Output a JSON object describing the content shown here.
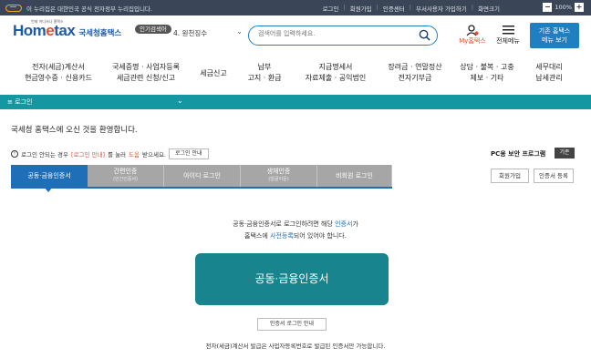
{
  "topbar": {
    "notice": "이 누리집은 대한민국 공식 전자정부 누리집입니다.",
    "links": [
      "로그인",
      "회원가입",
      "인증센터",
      "부서사용자 가입하기",
      "화면크기"
    ],
    "zoom": "100%",
    "zoom_minus": "−",
    "zoom_plus": "+"
  },
  "header": {
    "logo_home": "Hom",
    "logo_e": "e",
    "logo_tax": "tax",
    "logo_org": "국세청홈택스",
    "logo_tiny": "언제 어디서나 홈택스",
    "popular_label": "인기검색어",
    "popular_item": "4. 원천징수",
    "search_placeholder": "검색어를 입력하세요.",
    "my_home": "My홈택스",
    "all_menu": "전체메뉴",
    "old_home_line1": "기존 홈택스",
    "old_home_line2": "메뉴 보기"
  },
  "nav": [
    {
      "line1": "전자(세금)계산서",
      "line2": "현금영수증 · 신용카드"
    },
    {
      "line1": "국세증명 · 사업자등록",
      "line2": "세금관련 신청/신고"
    },
    {
      "line1": "세금신고",
      "line2": ""
    },
    {
      "line1": "납부",
      "line2": "고지 · 환급"
    },
    {
      "line1": "지급명세서",
      "line2": "자료제출 · 공익법인"
    },
    {
      "line1": "장려금 · 연말정산",
      "line2": "전자기부금"
    },
    {
      "line1": "상담 · 불복 · 고충",
      "line2": "제보 · 기타"
    },
    {
      "line1": "세무대리",
      "line2": "납세관리"
    }
  ],
  "loginbar": {
    "label": "≡  로그인",
    "chevron": "⌄"
  },
  "welcome": "국세청 홈택스에 오신 것을 환영합니다.",
  "hint": {
    "prefix": "로그인 안되는 경우",
    "red": "[로그인 안내]",
    "middle": "를 눌러",
    "help": "도움",
    "suffix": "받으세요.",
    "button": "로그인 안내"
  },
  "pc_security": {
    "label": "PC용 보안 프로그램",
    "button": "기존"
  },
  "tabs": [
    {
      "label": "공동·금융인증서",
      "sub": ""
    },
    {
      "label": "간편인증",
      "sub": "(민간인증서)"
    },
    {
      "label": "아이디 로그인",
      "sub": ""
    },
    {
      "label": "생체인증",
      "sub": "(얼굴지문)"
    },
    {
      "label": "비회원 로그인",
      "sub": ""
    }
  ],
  "side_buttons": {
    "join": "회원가입",
    "cert_register": "인증서 등록"
  },
  "description": {
    "line1_a": "공동·금융인증서로 로그인하려면 해당 ",
    "line1_b": "인증서",
    "line1_c": "가",
    "line2_a": "홈택스에 ",
    "line2_b": "사전등록",
    "line2_c": "되어 있어야 합니다."
  },
  "cert_button": "공동·금융인증서",
  "cert_guide": "인증서 로그인 안내",
  "footnote": "전자(세금)계산서 발급은 사업자등록번호로 발급된 인증서만 가능합니다.",
  "colors": {
    "teal": "#1497a1",
    "tab_active": "#1e6fb7",
    "cert_button": "#18858e"
  }
}
